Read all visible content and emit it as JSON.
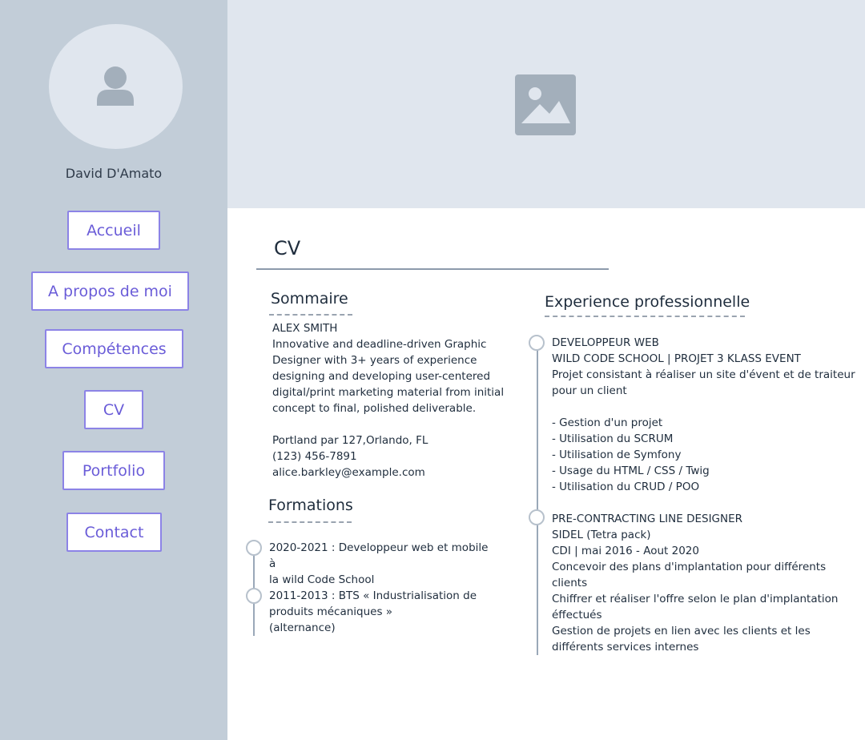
{
  "sidebar": {
    "avatar_icon": "user-icon",
    "name": "David D'Amato",
    "nav": [
      {
        "label": "Accueil"
      },
      {
        "label": "A propos de moi"
      },
      {
        "label": "Compétences"
      },
      {
        "label": "CV"
      },
      {
        "label": "Portfolio"
      },
      {
        "label": "Contact"
      }
    ]
  },
  "hero": {
    "icon": "image-placeholder-icon"
  },
  "page": {
    "title": "CV"
  },
  "summary": {
    "title": "Sommaire",
    "name": "ALEX SMITH",
    "lines": [
      "Innovative and deadline-driven Graphic",
      "Designer with 3+ years of experience",
      "designing and developing user-centered",
      "digital/print marketing material from initial",
      "concept to final, polished deliverable."
    ],
    "address": "Portland par 127,Orlando, FL",
    "phone": "(123) 456-7891",
    "email": "alice.barkley@example.com"
  },
  "education": {
    "title": "Formations",
    "items": [
      {
        "lines": [
          "2020-2021 : Developpeur web et mobile à",
          "la wild Code School"
        ]
      },
      {
        "lines": [
          "2011-2013 : BTS « Industrialisation de",
          "produits mécaniques »",
          "(alternance)"
        ]
      }
    ]
  },
  "experience": {
    "title": "Experience professionnelle",
    "items": [
      {
        "lines": [
          "DEVELOPPEUR WEB",
          "WILD CODE SCHOOL | PROJET 3 KLASS EVENT",
          "Projet consistant à réaliser un site d'évent et de traiteur",
          "pour un client",
          "",
          "- Gestion d'un projet",
          "- Utilisation du SCRUM",
          "- Utilisation de Symfony",
          "- Usage du HTML / CSS / Twig",
          "- Utilisation du CRUD / POO"
        ]
      },
      {
        "lines": [
          "PRE-CONTRACTING LINE DESIGNER",
          "SIDEL (Tetra pack)",
          "CDI | mai 2016 - Aout 2020",
          "Concevoir des plans d'implantation pour différents",
          "clients",
          "Chiffrer et réaliser l'offre selon le plan d'implantation",
          "éffectués",
          "Gestion de projets en lien avec les clients et les",
          "différents services internes"
        ]
      }
    ]
  },
  "colors": {
    "sidebar_bg": "#c2cdd8",
    "hero_bg": "#e0e6ee",
    "accent": "#6a5cd8",
    "button_border": "#8c83e6"
  }
}
